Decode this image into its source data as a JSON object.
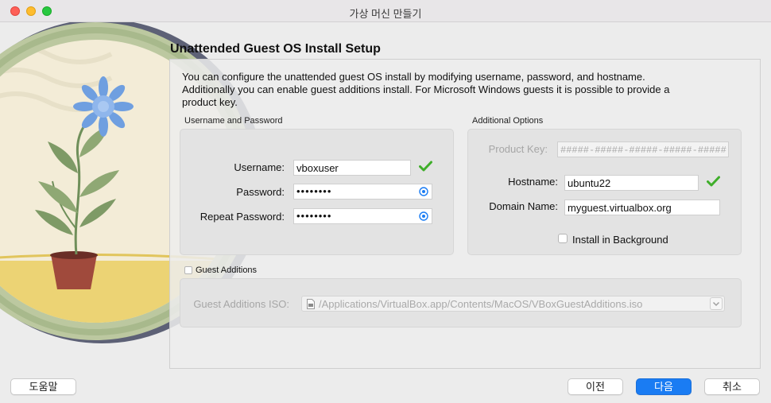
{
  "window": {
    "title": "가상 머신 만들기"
  },
  "page": {
    "title": "Unattended Guest OS Install Setup",
    "description": "You can configure the unattended guest OS install by modifying username, password, and hostname. Additionally you can enable guest additions install. For Microsoft Windows guests it is possible to provide a product key."
  },
  "user_group": {
    "label": "Username and Password",
    "username_label": "Username:",
    "username_value": "vboxuser",
    "password_label": "Password:",
    "password_value": "••••••••",
    "repeat_label": "Repeat Password:",
    "repeat_value": "••••••••"
  },
  "options_group": {
    "label": "Additional Options",
    "product_key_label": "Product Key:",
    "product_key_placeholder": "#####-#####-#####-#####-#####",
    "hostname_label": "Hostname:",
    "hostname_value": "ubuntu22",
    "domain_label": "Domain Name:",
    "domain_value": "myguest.virtualbox.org",
    "install_bg_label": "Install in Background",
    "install_bg_checked": false
  },
  "guest_additions": {
    "label": "Guest Additions",
    "checked": false,
    "iso_label": "Guest Additions ISO:",
    "iso_value": "/Applications/VirtualBox.app/Contents/MacOS/VBoxGuestAdditions.iso"
  },
  "buttons": {
    "help": "도움말",
    "back": "이전",
    "next": "다음",
    "cancel": "취소"
  },
  "colors": {
    "accent": "#1a7cf3",
    "valid_check": "#3fae2a"
  },
  "icons": [
    "close-dot",
    "minimize-dot",
    "maximize-dot",
    "check-icon",
    "eye-icon",
    "file-icon",
    "chevron-down-icon"
  ]
}
